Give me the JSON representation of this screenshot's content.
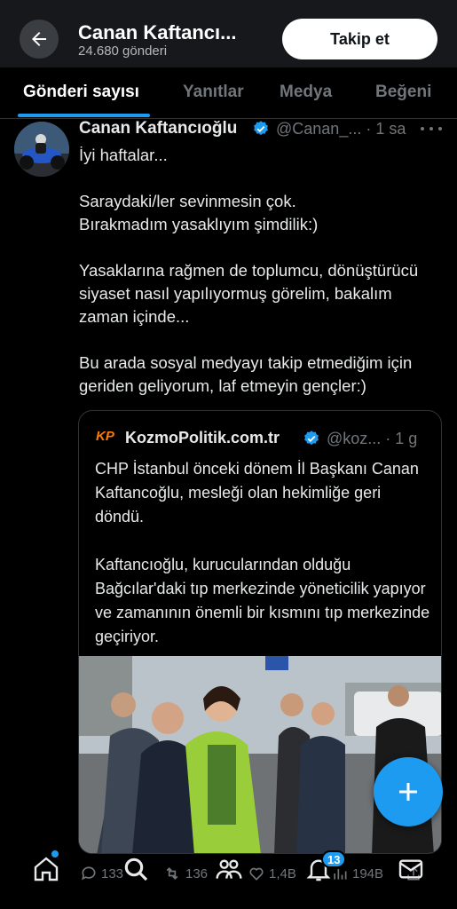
{
  "header": {
    "title": "Canan Kaftancı...",
    "post_count": "24.680 gönderi",
    "follow_label": "Takip et"
  },
  "tabs": [
    {
      "label": "Gönderi sayısı",
      "active": true
    },
    {
      "label": "Yanıtlar",
      "active": false
    },
    {
      "label": "Medya",
      "active": false
    },
    {
      "label": "Beğeni",
      "active": false
    }
  ],
  "tweet": {
    "author_name": "Canan Kaftancıoğlu",
    "handle_time": "@Canan_... · 1 sa",
    "paragraphs": [
      "İyi haftalar...",
      "Saraydaki/ler sevinmesin çok.\nBırakmadım yasaklıyım şimdilik:)",
      "Yasaklarına  rağmen de toplumcu, dönüştürücü siyaset nasıl yapılıyormuş görelim, bakalım zaman içinde...",
      "Bu arada sosyal medyayı takip etmediğim için geriden geliyorum, laf etmeyin gençler:)"
    ],
    "quote": {
      "logo_text": "KP",
      "name": "KozmoPolitik.com.tr",
      "handle_time": "@koz... · 1 g",
      "paragraphs": [
        "CHP İstanbul önceki dönem İl Başkanı Canan Kaftancoğlu, mesleği olan hekimliğe geri döndü.",
        "Kaftancıoğlu, kurucularından olduğu Bağcılar'daki tıp merkezinde yöneticilik yapıyor ve zamanının önemli bir kısmını tıp merkezinde geçiriyor."
      ]
    },
    "actions": {
      "replies": "133",
      "retweets": "136",
      "likes": "1,4B",
      "views": "194B"
    }
  },
  "bottom_nav": {
    "notification_count": "13"
  },
  "colors": {
    "accent": "#1d9bf0",
    "background": "#000000",
    "muted": "#71767b"
  }
}
